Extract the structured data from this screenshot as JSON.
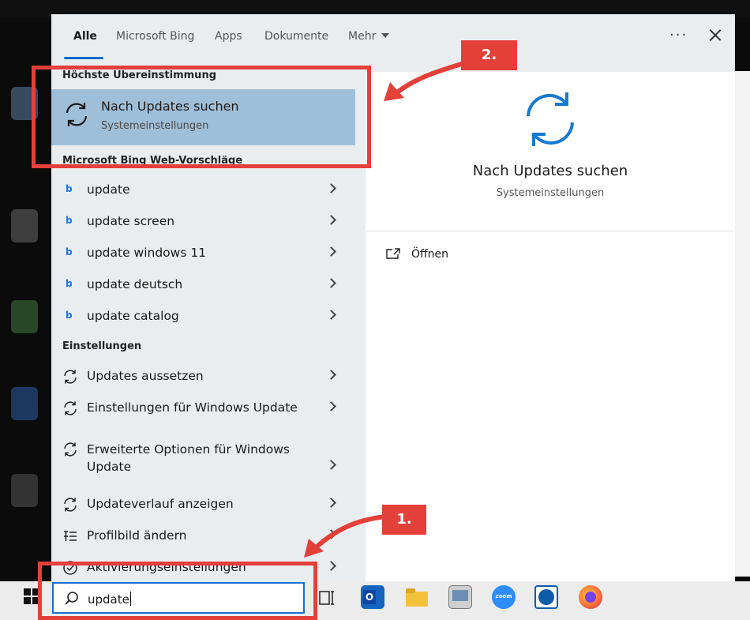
{
  "colors": {
    "accent": "#0b6cc9",
    "highlight": "#9fbed8",
    "annotation": "#e4403a",
    "panel": "#e9edf0"
  },
  "tabs": [
    {
      "label": "Alle",
      "active": true
    },
    {
      "label": "Microsoft Bing",
      "active": false
    },
    {
      "label": "Apps",
      "active": false
    },
    {
      "label": "Dokumente",
      "active": false
    },
    {
      "label": "Mehr",
      "active": false
    }
  ],
  "toolbar": {
    "more_icon": "more-dots-icon",
    "close_icon": "close-icon"
  },
  "best_match": {
    "header": "Höchste Übereinstimmung",
    "title": "Nach Updates suchen",
    "subtitle": "Systemeinstellungen",
    "icon": "sync-icon"
  },
  "web_suggestions": {
    "header": "Microsoft Bing Web-Vorschläge",
    "items": [
      {
        "label": "update",
        "icon": "bing-icon"
      },
      {
        "label": "update screen",
        "icon": "bing-icon"
      },
      {
        "label": "update windows 11",
        "icon": "bing-icon"
      },
      {
        "label": "update deutsch",
        "icon": "bing-icon"
      },
      {
        "label": "update catalog",
        "icon": "bing-icon"
      }
    ]
  },
  "settings": {
    "header": "Einstellungen",
    "items": [
      {
        "label": "Updates aussetzen",
        "icon": "sync-icon"
      },
      {
        "label": "Einstellungen für Windows Update",
        "icon": "sync-icon"
      },
      {
        "label": "Erweiterte Optionen für Windows Update",
        "icon": "sync-icon"
      },
      {
        "label": "Updateverlauf anzeigen",
        "icon": "sync-icon"
      },
      {
        "label": "Profilbild ändern",
        "icon": "profile-list-icon"
      },
      {
        "label": "Aktivierungseinstellungen",
        "icon": "check-circle-icon"
      }
    ]
  },
  "preview": {
    "title": "Nach Updates suchen",
    "subtitle": "Systemeinstellungen",
    "open_label": "Öffnen",
    "icon": "sync-icon"
  },
  "search": {
    "value": "update",
    "icon": "search-icon"
  },
  "taskbar": {
    "apps": [
      "windows-start-icon",
      "task-view-icon",
      "outlook-icon",
      "file-explorer-icon",
      "server-manager-icon",
      "zoom-icon",
      "teamviewer-icon",
      "firefox-icon"
    ]
  },
  "annotations": {
    "step1": "1.",
    "step2": "2."
  }
}
